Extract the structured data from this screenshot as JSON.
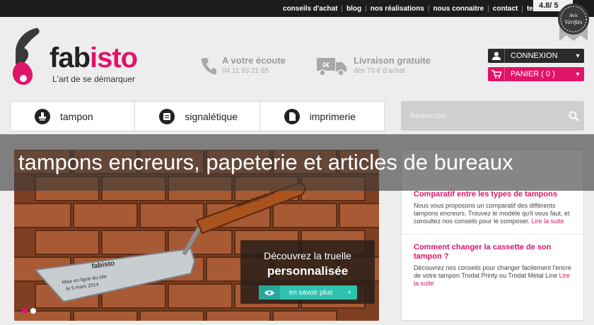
{
  "topnav": {
    "items": [
      "conseils d'achat",
      "blog",
      "nos réalisations",
      "nous connaitre",
      "contact"
    ],
    "tel": "tel : 0"
  },
  "rating": {
    "value": "4.8/ 5",
    "seal_text": "Avis Vérifiés"
  },
  "logo": {
    "name_part1": "fab",
    "name_part2": "isto",
    "tagline": "L'art de se démarquer"
  },
  "contact_info": {
    "title": "A votre écoute",
    "phone": "04 11 93 21 65"
  },
  "delivery_info": {
    "title": "Livraison gratuite",
    "detail": "dès 70 € d'achat",
    "truck_label": "0€"
  },
  "account": {
    "login_label": "CONNEXION",
    "cart_label": "PANIER ( 0 )"
  },
  "mainnav": {
    "items": [
      "tampon",
      "signalétique",
      "imprimerie"
    ]
  },
  "search": {
    "placeholder": "Rechercher"
  },
  "banner": {
    "line1": "Découvrez la truelle",
    "line2": "personnalisée",
    "button_label": "en savoir plus",
    "trowel_brand": "www.fabisto.fr",
    "blade_brand": "fabisto",
    "blade_text1": "Mise en ligne du site",
    "blade_text2": "le 5 mars 2014"
  },
  "articles": [
    {
      "title": "Comparatif entre les types de tampons",
      "body": "Nous vous proposons un comparatif des différents tampons encreurs. Trouvez le modèle qu'il vous faut, et consultez nos conseils pour le composer.",
      "more": "Lire la suite"
    },
    {
      "title": "Comment changer la cassette de son tampon ?",
      "body": "Découvrez nos conseils pour changer facilement l'encre de votre tampon Trodat Printy ou Trodat Metal Line",
      "more": "Lire la suite"
    }
  ],
  "overlay": {
    "caption": "tampons encreurs, papeterie et articles de bureaux"
  },
  "colors": {
    "brand_pink": "#e01469",
    "dark": "#1c1c1c",
    "teal": "#2ec1b0",
    "background": "#ededed"
  }
}
